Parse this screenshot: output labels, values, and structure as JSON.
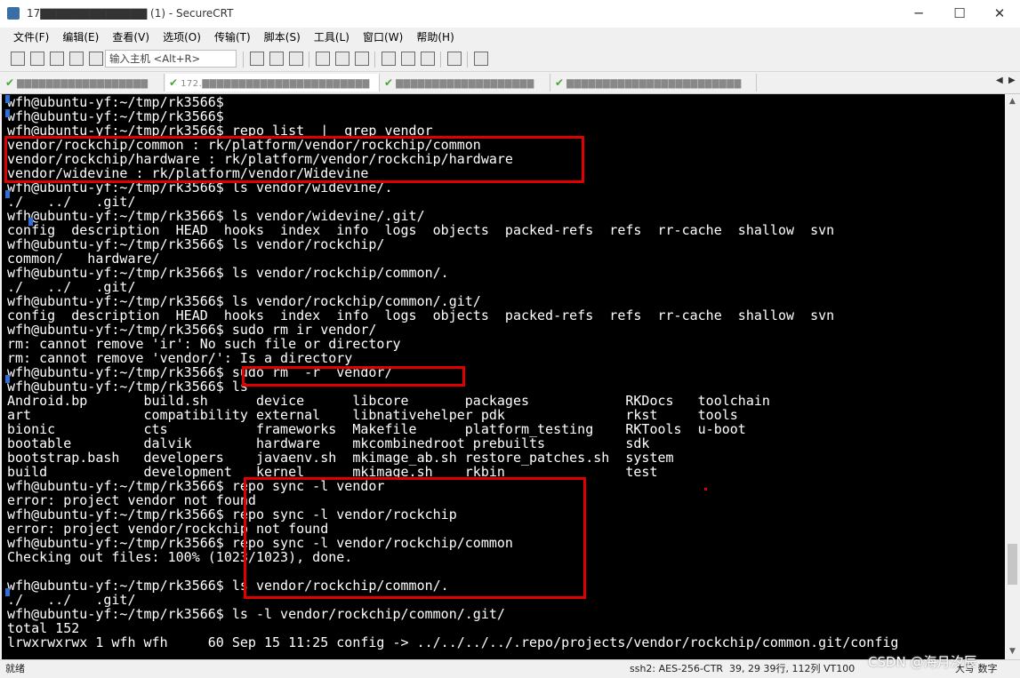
{
  "window": {
    "title": "17▇▇▇▇▇▇▇▇▇▇▇▇▇ (1) - SecureCRT",
    "minimize_glyph": "─",
    "maximize_glyph": "☐",
    "close_glyph": "✕"
  },
  "menu": [
    "文件(F)",
    "编辑(E)",
    "查看(V)",
    "选项(O)",
    "传输(T)",
    "脚本(S)",
    "工具(L)",
    "窗口(W)",
    "帮助(H)"
  ],
  "toolbar": {
    "host_input_placeholder": "输入主机 <Alt+R>"
  },
  "tabs": [
    {
      "label": "▇▇▇▇▇▇▇▇▇▇▇▇▇▇▇▇▇▇"
    },
    {
      "label": "172.▇▇▇▇▇▇▇▇▇▇▇▇▇▇▇▇▇▇▇▇▇▇▇"
    },
    {
      "label": "▇▇▇▇▇▇▇▇▇▇▇▇▇▇▇▇▇▇▇"
    },
    {
      "label": "▇▇▇▇▇▇▇▇▇▇▇▇▇▇▇▇▇▇▇▇▇▇▇▇"
    }
  ],
  "tab_nav": {
    "prev": "◀",
    "next": "▶"
  },
  "terminal_lines": [
    "wfh@ubuntu-yf:~/tmp/rk3566$",
    "wfh@ubuntu-yf:~/tmp/rk3566$",
    "wfh@ubuntu-yf:~/tmp/rk3566$ repo list  |  grep vendor",
    "vendor/rockchip/common : rk/platform/vendor/rockchip/common",
    "vendor/rockchip/hardware : rk/platform/vendor/rockchip/hardware",
    "vendor/widevine : rk/platform/vendor/Widevine",
    "wfh@ubuntu-yf:~/tmp/rk3566$ ls vendor/widevine/.",
    "./   ../   .git/",
    "wfh@ubuntu-yf:~/tmp/rk3566$ ls vendor/widevine/.git/",
    "config  description  HEAD  hooks  index  info  logs  objects  packed-refs  refs  rr-cache  shallow  svn",
    "wfh@ubuntu-yf:~/tmp/rk3566$ ls vendor/rockchip/",
    "common/   hardware/",
    "wfh@ubuntu-yf:~/tmp/rk3566$ ls vendor/rockchip/common/.",
    "./   ../   .git/",
    "wfh@ubuntu-yf:~/tmp/rk3566$ ls vendor/rockchip/common/.git/",
    "config  description  HEAD  hooks  index  info  logs  objects  packed-refs  refs  rr-cache  shallow  svn",
    "wfh@ubuntu-yf:~/tmp/rk3566$ sudo rm ir vendor/",
    "rm: cannot remove 'ir': No such file or directory",
    "rm: cannot remove 'vendor/': Is a directory",
    "wfh@ubuntu-yf:~/tmp/rk3566$ sudo rm  -r  vendor/",
    "wfh@ubuntu-yf:~/tmp/rk3566$ ls",
    "Android.bp       build.sh      device      libcore       packages            RKDocs   toolchain",
    "art              compatibility external    libnativehelper pdk               rkst     tools",
    "bionic           cts           frameworks  Makefile      platform_testing    RKTools  u-boot",
    "bootable         dalvik        hardware    mkcombinedroot prebuilts          sdk",
    "bootstrap.bash   developers    javaenv.sh  mkimage_ab.sh restore_patches.sh  system",
    "build            development   kernel      mkimage.sh    rkbin               test",
    "wfh@ubuntu-yf:~/tmp/rk3566$ repo sync -l vendor",
    "error: project vendor not found",
    "wfh@ubuntu-yf:~/tmp/rk3566$ repo sync -l vendor/rockchip",
    "error: project vendor/rockchip not found",
    "wfh@ubuntu-yf:~/tmp/rk3566$ repo sync -l vendor/rockchip/common",
    "Checking out files: 100% (1023/1023), done.",
    "",
    "wfh@ubuntu-yf:~/tmp/rk3566$ ls vendor/rockchip/common/.",
    "./   ../   .git/",
    "wfh@ubuntu-yf:~/tmp/rk3566$ ls -l vendor/rockchip/common/.git/",
    "total 152",
    "lrwxrwxrwx 1 wfh wfh     60 Sep 15 11:25 config -> ../../../../.repo/projects/vendor/rockchip/common.git/config"
  ],
  "scrollbar": {
    "up": "▲",
    "down": "▼"
  },
  "status": {
    "ready": "就绪",
    "cipher": "ssh2: AES-256-CTR",
    "position": "39, 29  39行, 112列  VT100",
    "caps": "大写  数字"
  },
  "watermark": "CSDN @海月汐辰",
  "colors": {
    "terminal_bg": "#000000",
    "terminal_fg": "#ffffff",
    "highlight": "#e00000"
  }
}
